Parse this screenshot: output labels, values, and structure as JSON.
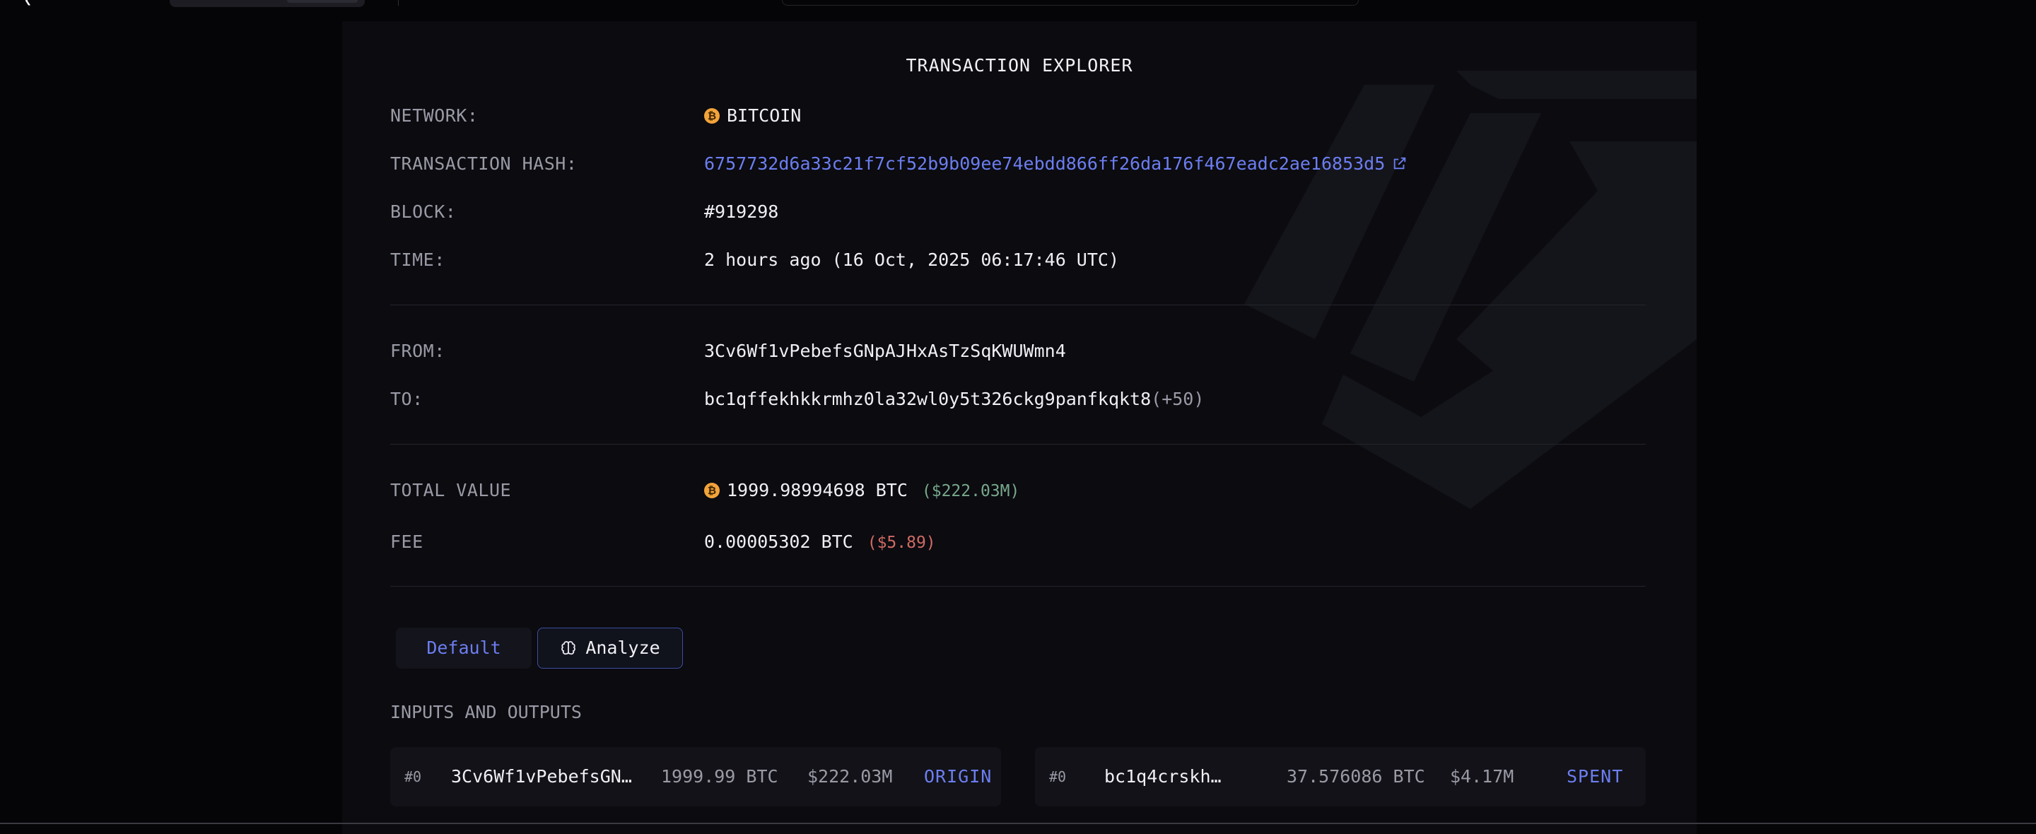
{
  "header": {
    "back_glyph": "❮",
    "back_icon": "back-arrow-icon"
  },
  "explorer": {
    "title": "TRANSACTION EXPLORER",
    "network": {
      "label": "NETWORK:",
      "value": "BITCOIN",
      "coin_symbol": "₿",
      "coin_color": "#f2a33a"
    },
    "hash": {
      "label": "TRANSACTION HASH:",
      "value": "6757732d6a33c21f7cf52b9b09ee74ebdd866ff26da176f467eadc2ae16853d5",
      "link_color": "#6c7ef0"
    },
    "block": {
      "label": "BLOCK:",
      "value": "#919298"
    },
    "time": {
      "label": "TIME:",
      "value": "2 hours ago  (16 Oct, 2025 06:17:46 UTC)"
    },
    "from": {
      "label": "FROM:",
      "value": "3Cv6Wf1vPebefsGNpAJHxAsTzSqKWUWmn4"
    },
    "to": {
      "label": "TO:",
      "value": "bc1qffekhkkrmhz0la32wl0y5t326ckg9panfkqkt8",
      "extra": "(+50)"
    },
    "total_value": {
      "label": "TOTAL VALUE",
      "amount": "1999.98994698 BTC",
      "usd": "($222.03M)",
      "usd_color": "#77a88b"
    },
    "fee": {
      "label": "FEE",
      "amount": "0.00005302 BTC",
      "usd": "($5.89)",
      "usd_color": "#d06a63"
    }
  },
  "tabs": [
    {
      "label": "Default",
      "selected": false
    },
    {
      "label": "Analyze",
      "selected": true,
      "icon": "brain-icon"
    }
  ],
  "io": {
    "section_label": "INPUTS AND OUTPUTS",
    "inputs": [
      {
        "index": "#0",
        "address": "3Cv6Wf1vPebefsGN…",
        "btc": "1999.99 BTC",
        "usd": "$222.03M",
        "status": "ORIGIN"
      }
    ],
    "outputs": [
      {
        "index": "#0",
        "address": "bc1q4crskh…",
        "btc": "37.576086 BTC",
        "usd": "$4.17M",
        "status": "SPENT"
      }
    ]
  }
}
